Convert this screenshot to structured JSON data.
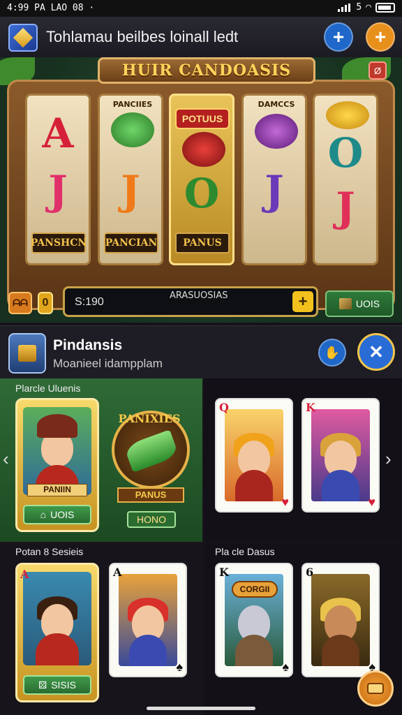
{
  "status_bar": {
    "time": "4:99 PA LAO 08 ·",
    "signal": "5"
  },
  "top_bar": {
    "title": "Tohlamau beilbes loinall ledt",
    "add_icon": "plus-icon",
    "gold_icon": "plus-icon",
    "add_color": "#1f67c8",
    "gold_color": "#e8901c"
  },
  "machine": {
    "banner": "HUIR CANDOASIS",
    "reels": [
      {
        "top": "A",
        "bottom": "J",
        "label": "PANSHCN",
        "top_color": "#d6203a",
        "bottom_color": "#e0306a"
      },
      {
        "tag": "PANCIIES",
        "bottom": "J",
        "label": "PANCIAN",
        "bottom_color": "#f07a1a"
      },
      {
        "tag": "POTUUS",
        "bottom": "O",
        "label": "PANUS",
        "bottom_color": "#2e8a2e"
      },
      {
        "tag": "DAMCCS",
        "bottom": "J",
        "label": "",
        "bottom_color": "#6a3ab8"
      },
      {
        "top": "O",
        "bottom": "J",
        "label": "",
        "top_color": "#1f8a8a",
        "bottom_color": "#e0305a"
      }
    ],
    "balance": "S:190",
    "balance_label": "ARASUOSIAS",
    "left_btn": "ᗩᗩ",
    "small_btn": "0",
    "plus": "+",
    "right_btn": "UOIS"
  },
  "profile": {
    "name": "Pindansis",
    "subtitle": "Moanieel idampplam",
    "btn1_icon": "hand-icon",
    "btn2_icon": "close-icon"
  },
  "sections": [
    {
      "title": "Plarcle Uluenis",
      "hero_label": "PANIIN",
      "hero_btn": "UOIS",
      "emblem_title": "PANIXIES",
      "emblem_sub": "PANUS",
      "emblem_btn": "HONO"
    },
    {
      "title": "Potan 8 Sesieis",
      "hero_btn": "SISIS"
    },
    {
      "title": "Pla cle Dasus"
    }
  ],
  "cards": [
    {
      "index": "Q",
      "suit": "♥",
      "color": "#d6203a"
    },
    {
      "index": "K",
      "suit": "♥",
      "color": "#d6203a"
    },
    {
      "index": "A",
      "suit": "♥",
      "color": "#d6203a"
    },
    {
      "index": "A",
      "suit": "♠",
      "color": "#111111"
    },
    {
      "index": "K",
      "suit": "♠",
      "color": "#111111"
    },
    {
      "index": "6",
      "suit": "♠",
      "color": "#111111"
    }
  ],
  "emblem_text": "CORGII",
  "nav": {
    "left": "‹",
    "right": "›"
  }
}
